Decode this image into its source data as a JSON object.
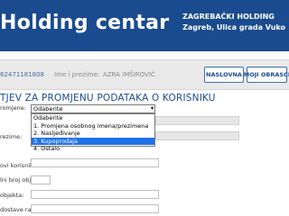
{
  "header": {
    "logo": "Holding centar",
    "org_line1": "ZAGREBAČKI HOLDING",
    "org_line2": "Zagreb, Ulica grada Vuko"
  },
  "infobar": {
    "oib": "62471181808",
    "name_label": "Ime i prezime:",
    "name_value": "AZRA IMŠIROVIĆ",
    "home_button": "NASLOVNA",
    "requests_button": "MOJI OBRASCI"
  },
  "page_title": "TJEV ZA PROMJENU PODATAKA O KORISNIKU",
  "form": {
    "reason_label": "romjene:",
    "reason_selected": "Odaberite",
    "reason_options": [
      "Odaberite",
      "1. Promjena osobnog imena/prezimena",
      "2. Nasljeđivanje",
      "3. Kupoprodaja",
      "4. Ostalo"
    ],
    "reason_highlighted_index": 3,
    "prezime_label": "rezime:",
    "new_user_label": "ovi korisnik:*",
    "unit_label": "lni broj objekta:",
    "object_label": "objekta:",
    "account_label": "dostave računa:"
  }
}
